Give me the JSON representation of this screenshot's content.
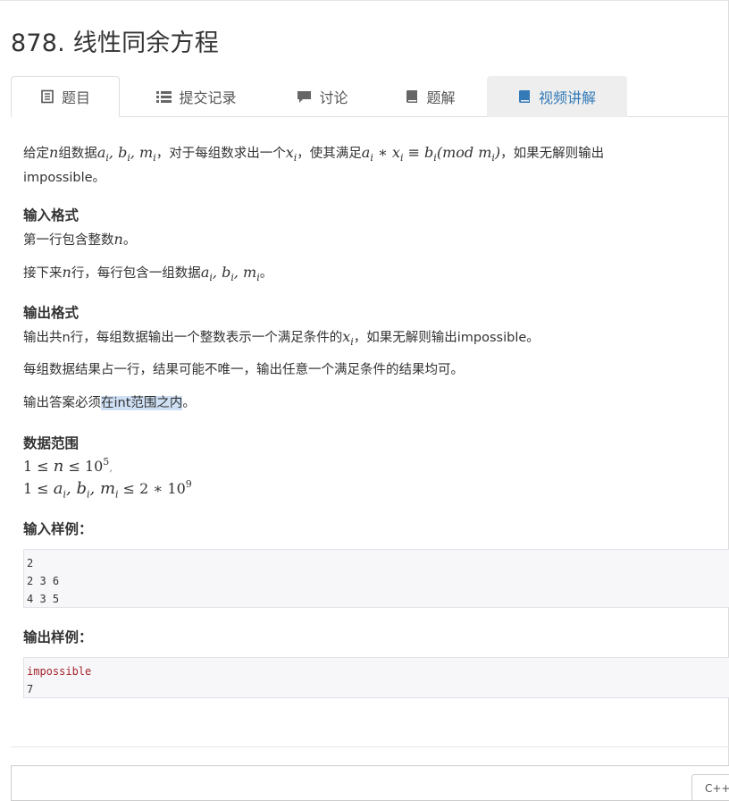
{
  "problem": {
    "title": "878. 线性同余方程"
  },
  "tabs": [
    {
      "label": "题目",
      "icon": "document-icon",
      "active": true
    },
    {
      "label": "提交记录",
      "icon": "list-icon",
      "active": false
    },
    {
      "label": "讨论",
      "icon": "comment-icon",
      "active": false
    },
    {
      "label": "题解",
      "icon": "book-icon",
      "active": false
    },
    {
      "label": "视频讲解",
      "icon": "book-icon",
      "active": false,
      "highlighted": true
    }
  ],
  "statement": {
    "p1_a": "给定",
    "p1_n": "n",
    "p1_b": "组数据",
    "p1_vars": "a",
    "p1_c": "，对于每组数求出一个",
    "p1_d": "，使其满足",
    "p1_e": "，如果无解则输出",
    "p1_f": "impossible。"
  },
  "input_format": {
    "heading": "输入格式",
    "line1_a": "第一行包含整数",
    "line1_b": "。",
    "line2_a": "接下来",
    "line2_b": "行，每行包含一组数据",
    "line2_c": "。"
  },
  "output_format": {
    "heading": "输出格式",
    "line1_a": "输出共n行，每组数据输出一个整数表示一个满足条件的",
    "line1_b": "，如果无解则输出impossible。",
    "line2": "每组数据结果占一行，结果可能不唯一，输出任意一个满足条件的结果均可。",
    "line3_a": "输出答案必须",
    "line3_hl": "在int范围之内",
    "line3_b": "。"
  },
  "range": {
    "heading": "数据范围",
    "line1_sep": ",",
    "exp1": "5",
    "exp2": "9"
  },
  "sample_input": {
    "heading": "输入样例：",
    "lines": [
      "2",
      "2 3 6",
      "4 3 5"
    ]
  },
  "sample_output": {
    "heading": "输出样例：",
    "lines": [
      "impossible",
      "7"
    ]
  },
  "editor": {
    "lang_label": "C++"
  },
  "colors": {
    "link": "#337ab7",
    "tab_bg": "#eeeeee",
    "highlight": "#cfe0f5",
    "code_red": "#a3242b"
  }
}
